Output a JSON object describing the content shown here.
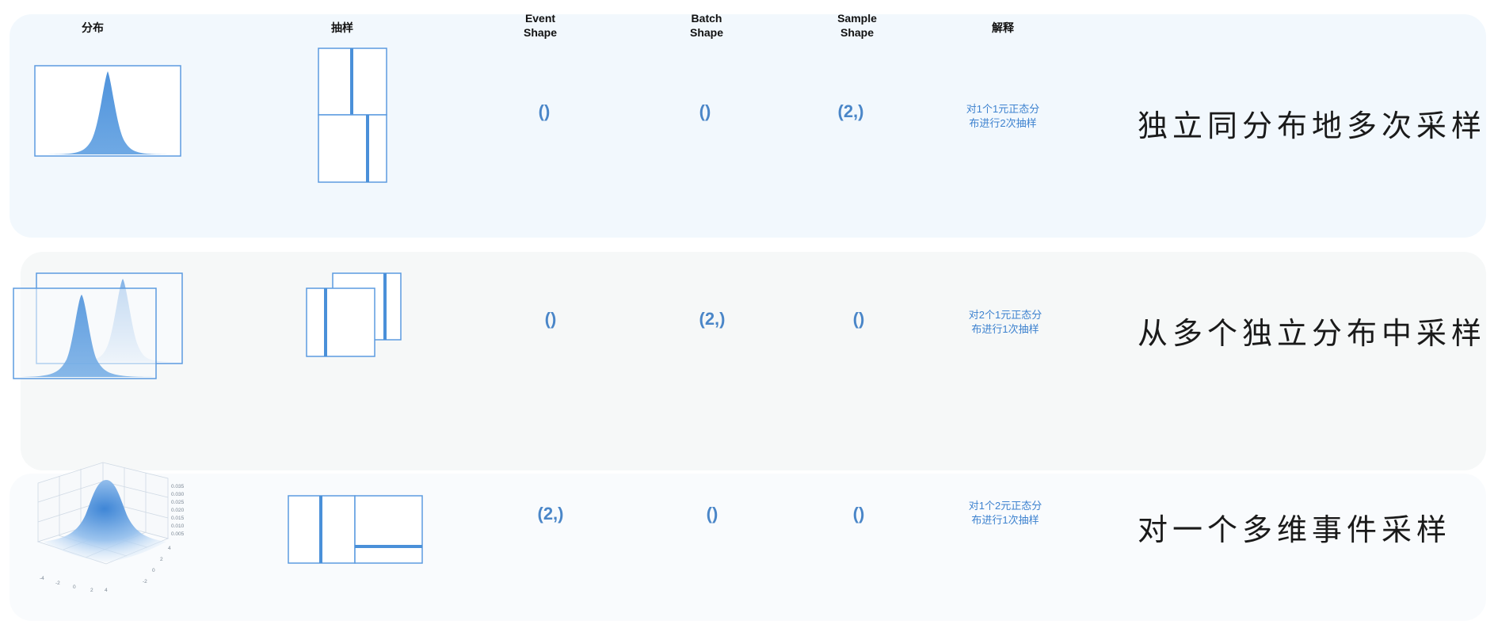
{
  "headers": {
    "distribution": "分布",
    "sampling": "抽样",
    "event_shape": [
      "Event",
      "Shape"
    ],
    "batch_shape": [
      "Batch",
      "Shape"
    ],
    "sample_shape": [
      "Sample",
      "Shape"
    ],
    "explanation": "解释"
  },
  "rows": [
    {
      "event_shape": "()",
      "batch_shape": "()",
      "sample_shape": "(2,)",
      "explanation": [
        "对1个1元正态分",
        "布进行2次抽样"
      ],
      "description": "独立同分布地多次采样"
    },
    {
      "event_shape": "()",
      "batch_shape": "(2,)",
      "sample_shape": "()",
      "explanation": [
        "对2个1元正态分",
        "布进行1次抽样"
      ],
      "description": "从多个独立分布中采样"
    },
    {
      "event_shape": "(2,)",
      "batch_shape": "()",
      "sample_shape": "()",
      "explanation": [
        "对1个2元正态分",
        "布进行1次抽样"
      ],
      "description": "对一个多维事件采样"
    }
  ],
  "surface_plot": {
    "z_ticks": [
      "0.035",
      "0.030",
      "0.025",
      "0.020",
      "0.015",
      "0.010",
      "0.005"
    ],
    "x_ticks": [
      "-4",
      "-2",
      "0",
      "2",
      "4"
    ],
    "y_ticks": [
      "4",
      "2",
      "0",
      "-2"
    ]
  },
  "colors": {
    "accent": "#4a90d9",
    "value_text": "#4a86c8",
    "explanation_text": "#3d82cf"
  }
}
